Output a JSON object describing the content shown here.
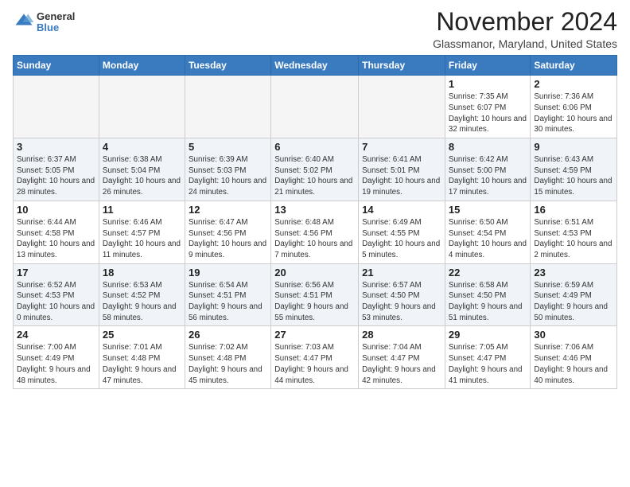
{
  "header": {
    "logo_general": "General",
    "logo_blue": "Blue",
    "month_title": "November 2024",
    "location": "Glassmanor, Maryland, United States"
  },
  "calendar": {
    "days_of_week": [
      "Sunday",
      "Monday",
      "Tuesday",
      "Wednesday",
      "Thursday",
      "Friday",
      "Saturday"
    ],
    "weeks": [
      [
        {
          "day": "",
          "info": ""
        },
        {
          "day": "",
          "info": ""
        },
        {
          "day": "",
          "info": ""
        },
        {
          "day": "",
          "info": ""
        },
        {
          "day": "",
          "info": ""
        },
        {
          "day": "1",
          "info": "Sunrise: 7:35 AM\nSunset: 6:07 PM\nDaylight: 10 hours and 32 minutes."
        },
        {
          "day": "2",
          "info": "Sunrise: 7:36 AM\nSunset: 6:06 PM\nDaylight: 10 hours and 30 minutes."
        }
      ],
      [
        {
          "day": "3",
          "info": "Sunrise: 6:37 AM\nSunset: 5:05 PM\nDaylight: 10 hours and 28 minutes."
        },
        {
          "day": "4",
          "info": "Sunrise: 6:38 AM\nSunset: 5:04 PM\nDaylight: 10 hours and 26 minutes."
        },
        {
          "day": "5",
          "info": "Sunrise: 6:39 AM\nSunset: 5:03 PM\nDaylight: 10 hours and 24 minutes."
        },
        {
          "day": "6",
          "info": "Sunrise: 6:40 AM\nSunset: 5:02 PM\nDaylight: 10 hours and 21 minutes."
        },
        {
          "day": "7",
          "info": "Sunrise: 6:41 AM\nSunset: 5:01 PM\nDaylight: 10 hours and 19 minutes."
        },
        {
          "day": "8",
          "info": "Sunrise: 6:42 AM\nSunset: 5:00 PM\nDaylight: 10 hours and 17 minutes."
        },
        {
          "day": "9",
          "info": "Sunrise: 6:43 AM\nSunset: 4:59 PM\nDaylight: 10 hours and 15 minutes."
        }
      ],
      [
        {
          "day": "10",
          "info": "Sunrise: 6:44 AM\nSunset: 4:58 PM\nDaylight: 10 hours and 13 minutes."
        },
        {
          "day": "11",
          "info": "Sunrise: 6:46 AM\nSunset: 4:57 PM\nDaylight: 10 hours and 11 minutes."
        },
        {
          "day": "12",
          "info": "Sunrise: 6:47 AM\nSunset: 4:56 PM\nDaylight: 10 hours and 9 minutes."
        },
        {
          "day": "13",
          "info": "Sunrise: 6:48 AM\nSunset: 4:56 PM\nDaylight: 10 hours and 7 minutes."
        },
        {
          "day": "14",
          "info": "Sunrise: 6:49 AM\nSunset: 4:55 PM\nDaylight: 10 hours and 5 minutes."
        },
        {
          "day": "15",
          "info": "Sunrise: 6:50 AM\nSunset: 4:54 PM\nDaylight: 10 hours and 4 minutes."
        },
        {
          "day": "16",
          "info": "Sunrise: 6:51 AM\nSunset: 4:53 PM\nDaylight: 10 hours and 2 minutes."
        }
      ],
      [
        {
          "day": "17",
          "info": "Sunrise: 6:52 AM\nSunset: 4:53 PM\nDaylight: 10 hours and 0 minutes."
        },
        {
          "day": "18",
          "info": "Sunrise: 6:53 AM\nSunset: 4:52 PM\nDaylight: 9 hours and 58 minutes."
        },
        {
          "day": "19",
          "info": "Sunrise: 6:54 AM\nSunset: 4:51 PM\nDaylight: 9 hours and 56 minutes."
        },
        {
          "day": "20",
          "info": "Sunrise: 6:56 AM\nSunset: 4:51 PM\nDaylight: 9 hours and 55 minutes."
        },
        {
          "day": "21",
          "info": "Sunrise: 6:57 AM\nSunset: 4:50 PM\nDaylight: 9 hours and 53 minutes."
        },
        {
          "day": "22",
          "info": "Sunrise: 6:58 AM\nSunset: 4:50 PM\nDaylight: 9 hours and 51 minutes."
        },
        {
          "day": "23",
          "info": "Sunrise: 6:59 AM\nSunset: 4:49 PM\nDaylight: 9 hours and 50 minutes."
        }
      ],
      [
        {
          "day": "24",
          "info": "Sunrise: 7:00 AM\nSunset: 4:49 PM\nDaylight: 9 hours and 48 minutes."
        },
        {
          "day": "25",
          "info": "Sunrise: 7:01 AM\nSunset: 4:48 PM\nDaylight: 9 hours and 47 minutes."
        },
        {
          "day": "26",
          "info": "Sunrise: 7:02 AM\nSunset: 4:48 PM\nDaylight: 9 hours and 45 minutes."
        },
        {
          "day": "27",
          "info": "Sunrise: 7:03 AM\nSunset: 4:47 PM\nDaylight: 9 hours and 44 minutes."
        },
        {
          "day": "28",
          "info": "Sunrise: 7:04 AM\nSunset: 4:47 PM\nDaylight: 9 hours and 42 minutes."
        },
        {
          "day": "29",
          "info": "Sunrise: 7:05 AM\nSunset: 4:47 PM\nDaylight: 9 hours and 41 minutes."
        },
        {
          "day": "30",
          "info": "Sunrise: 7:06 AM\nSunset: 4:46 PM\nDaylight: 9 hours and 40 minutes."
        }
      ]
    ]
  }
}
